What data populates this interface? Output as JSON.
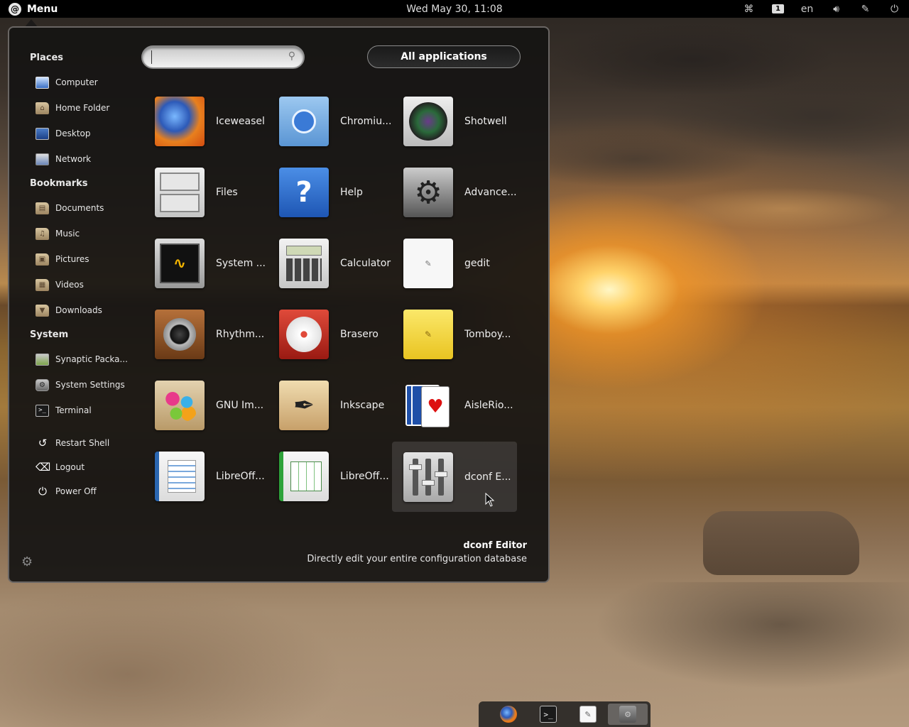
{
  "topbar": {
    "menu_label": "Menu",
    "clock": "Wed May 30, 11:08",
    "workspace": "1",
    "keyboard": "en"
  },
  "sidebar": {
    "places_title": "Places",
    "places": [
      {
        "label": "Computer",
        "icon": "computer-icon"
      },
      {
        "label": "Home Folder",
        "icon": "home-folder-icon"
      },
      {
        "label": "Desktop",
        "icon": "desktop-icon"
      },
      {
        "label": "Network",
        "icon": "network-icon"
      }
    ],
    "bookmarks_title": "Bookmarks",
    "bookmarks": [
      {
        "label": "Documents",
        "icon": "folder-documents-icon"
      },
      {
        "label": "Music",
        "icon": "folder-music-icon"
      },
      {
        "label": "Pictures",
        "icon": "folder-pictures-icon"
      },
      {
        "label": "Videos",
        "icon": "folder-videos-icon"
      },
      {
        "label": "Downloads",
        "icon": "folder-downloads-icon"
      }
    ],
    "system_title": "System",
    "system": [
      {
        "label": "Synaptic Packa...",
        "icon": "synaptic-icon"
      },
      {
        "label": "System Settings",
        "icon": "system-settings-icon"
      },
      {
        "label": "Terminal",
        "icon": "terminal-icon"
      }
    ],
    "actions": [
      {
        "label": "Restart Shell",
        "icon": "restart-icon"
      },
      {
        "label": "Logout",
        "icon": "logout-icon"
      },
      {
        "label": "Power Off",
        "icon": "power-icon"
      }
    ]
  },
  "search": {
    "placeholder": "",
    "value": ""
  },
  "all_apps_label": "All applications",
  "apps": [
    {
      "label": "Iceweasel",
      "icon": "iceweasel-icon"
    },
    {
      "label": "Chromiu...",
      "icon": "chromium-icon"
    },
    {
      "label": "Shotwell",
      "icon": "shotwell-icon"
    },
    {
      "label": "Files",
      "icon": "files-icon"
    },
    {
      "label": "Help",
      "icon": "help-icon"
    },
    {
      "label": "Advance...",
      "icon": "advanced-settings-icon"
    },
    {
      "label": "System ...",
      "icon": "system-monitor-icon"
    },
    {
      "label": "Calculator",
      "icon": "calculator-icon"
    },
    {
      "label": "gedit",
      "icon": "gedit-icon"
    },
    {
      "label": "Rhythm...",
      "icon": "rhythmbox-icon"
    },
    {
      "label": "Brasero",
      "icon": "brasero-icon"
    },
    {
      "label": "Tomboy...",
      "icon": "tomboy-icon"
    },
    {
      "label": "GNU Im...",
      "icon": "gimp-icon"
    },
    {
      "label": "Inkscape",
      "icon": "inkscape-icon"
    },
    {
      "label": "AisleRio...",
      "icon": "aisleriot-icon"
    },
    {
      "label": "LibreOff...",
      "icon": "libreoffice-writer-icon"
    },
    {
      "label": "LibreOff...",
      "icon": "libreoffice-calc-icon"
    },
    {
      "label": "dconf E...",
      "icon": "dconf-editor-icon"
    }
  ],
  "selected_app": {
    "name": "dconf Editor",
    "description": "Directly edit your entire configuration database"
  },
  "dock": [
    {
      "icon": "firefox-icon"
    },
    {
      "icon": "terminal-icon"
    },
    {
      "icon": "gedit-icon"
    },
    {
      "icon": "dconf-editor-icon"
    }
  ]
}
